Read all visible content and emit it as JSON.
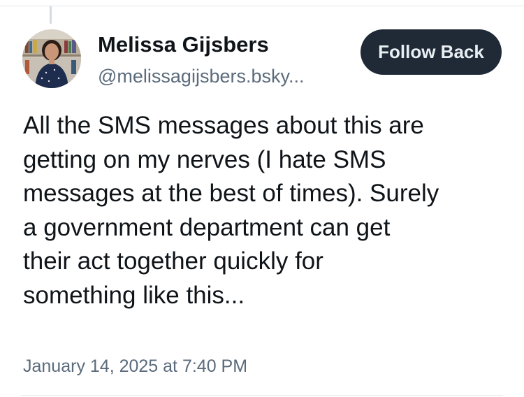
{
  "post": {
    "author": {
      "display_name": "Melissa Gijsbers",
      "handle": "@melissagijsbers.bsky...",
      "avatar_icon": "profile-photo"
    },
    "follow_button": {
      "label": "Follow Back"
    },
    "text_lines": [
      "All the SMS messages about this are",
      "getting on my nerves (I hate SMS",
      "messages at the best of times). Surely",
      "a government department can get",
      "their act together quickly for",
      "something like this..."
    ],
    "timestamp": "January 14, 2025 at 7:40 PM"
  },
  "colors": {
    "button_bg": "#1f2a36",
    "button_text": "#e9eef3",
    "secondary_text": "#5b6b7b",
    "primary_text": "#0f1419",
    "divider": "#e3e7eb"
  }
}
